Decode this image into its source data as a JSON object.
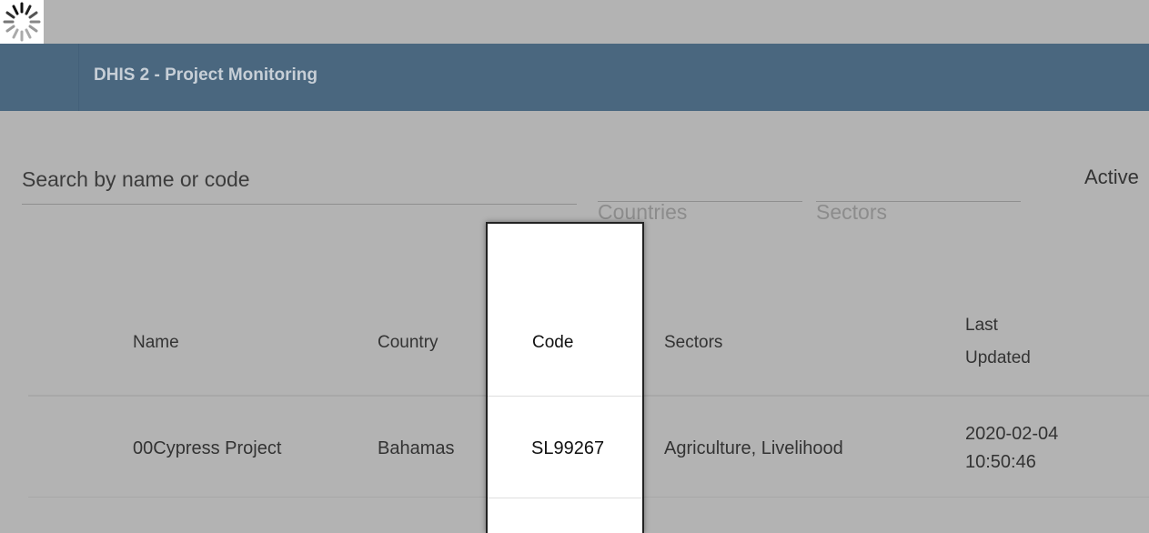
{
  "spinner": {
    "icon": "loading-spinner-icon"
  },
  "appbar": {
    "title": "DHIS 2 - Project Monitoring"
  },
  "filters": {
    "search_placeholder": "Search by name or code",
    "countries_label": "Countries",
    "sectors_label": "Sectors",
    "active_label": "Active"
  },
  "table": {
    "headers": {
      "name": "Name",
      "country": "Country",
      "code": "Code",
      "sectors": "Sectors",
      "last_updated_line1": "Last",
      "last_updated_line2": "Updated"
    },
    "rows": [
      {
        "name": "00Cypress Project",
        "country": "Bahamas",
        "code": "SL99267",
        "sectors": "Agriculture, Livelihood",
        "last_updated_date": "2020-02-04",
        "last_updated_time": "10:50:46"
      }
    ]
  }
}
